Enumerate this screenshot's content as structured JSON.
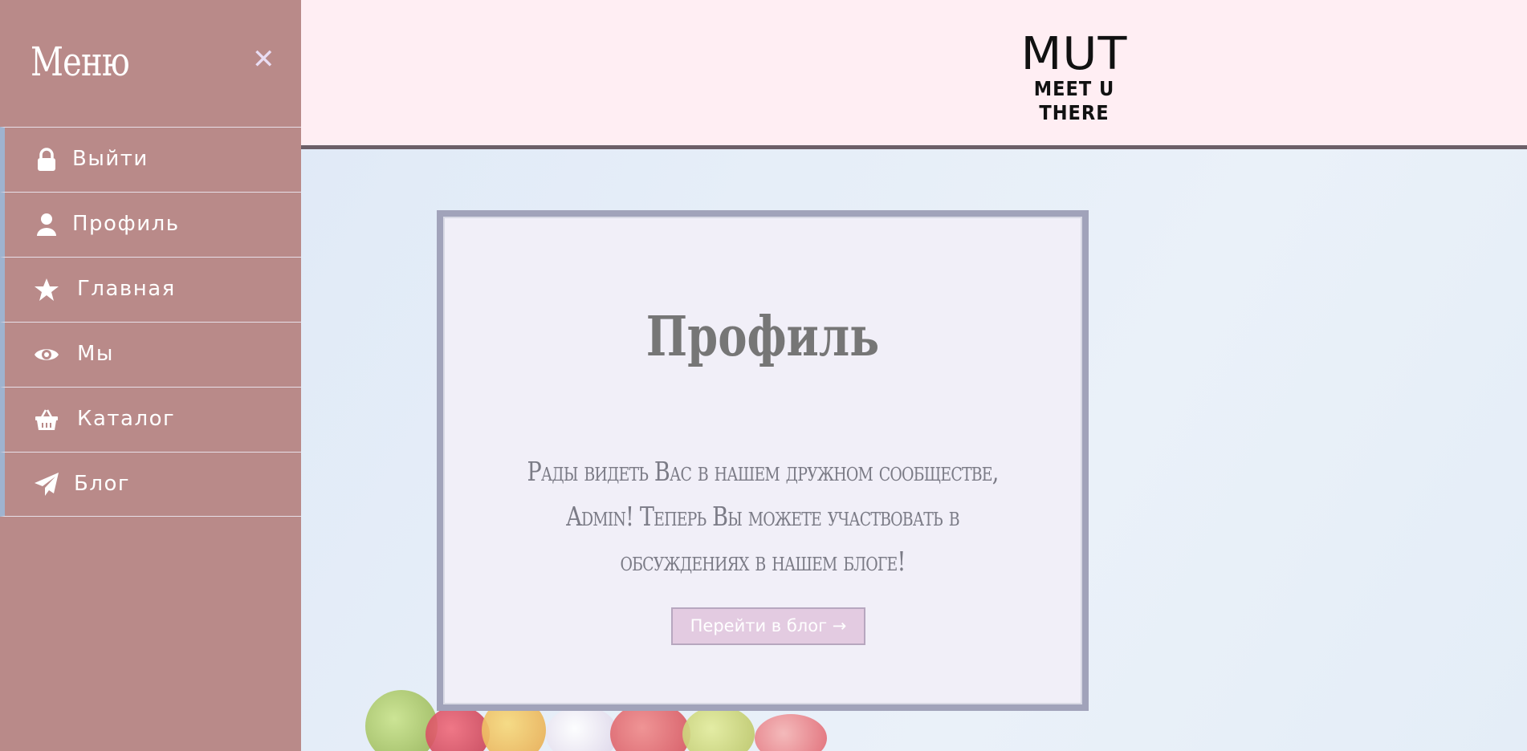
{
  "header": {
    "logo_main": "MUT",
    "logo_sub": "MEET U THERE"
  },
  "sidebar": {
    "title": "Меню",
    "close_symbol": "✕",
    "items": [
      {
        "label": "Выйти",
        "icon": "lock-icon"
      },
      {
        "label": "Профиль",
        "icon": "user-icon"
      },
      {
        "label": "Главная",
        "icon": "star-icon"
      },
      {
        "label": "Мы",
        "icon": "eye-icon"
      },
      {
        "label": "Каталог",
        "icon": "basket-icon"
      },
      {
        "label": "Блог",
        "icon": "paper-plane-icon"
      }
    ]
  },
  "card": {
    "title": "Профиль",
    "message": "Рады видеть Вас в нашем дружном сообществе, Admin! Теперь Вы можете участвовать в обсуждениях в нашем блоге!",
    "button_label": "Перейти в блог →"
  },
  "colors": {
    "sidebar_bg": "#b98a89",
    "header_bg": "#ffeef3",
    "card_bg": "#f1eff8",
    "button_bg": "#e3cbe1"
  }
}
